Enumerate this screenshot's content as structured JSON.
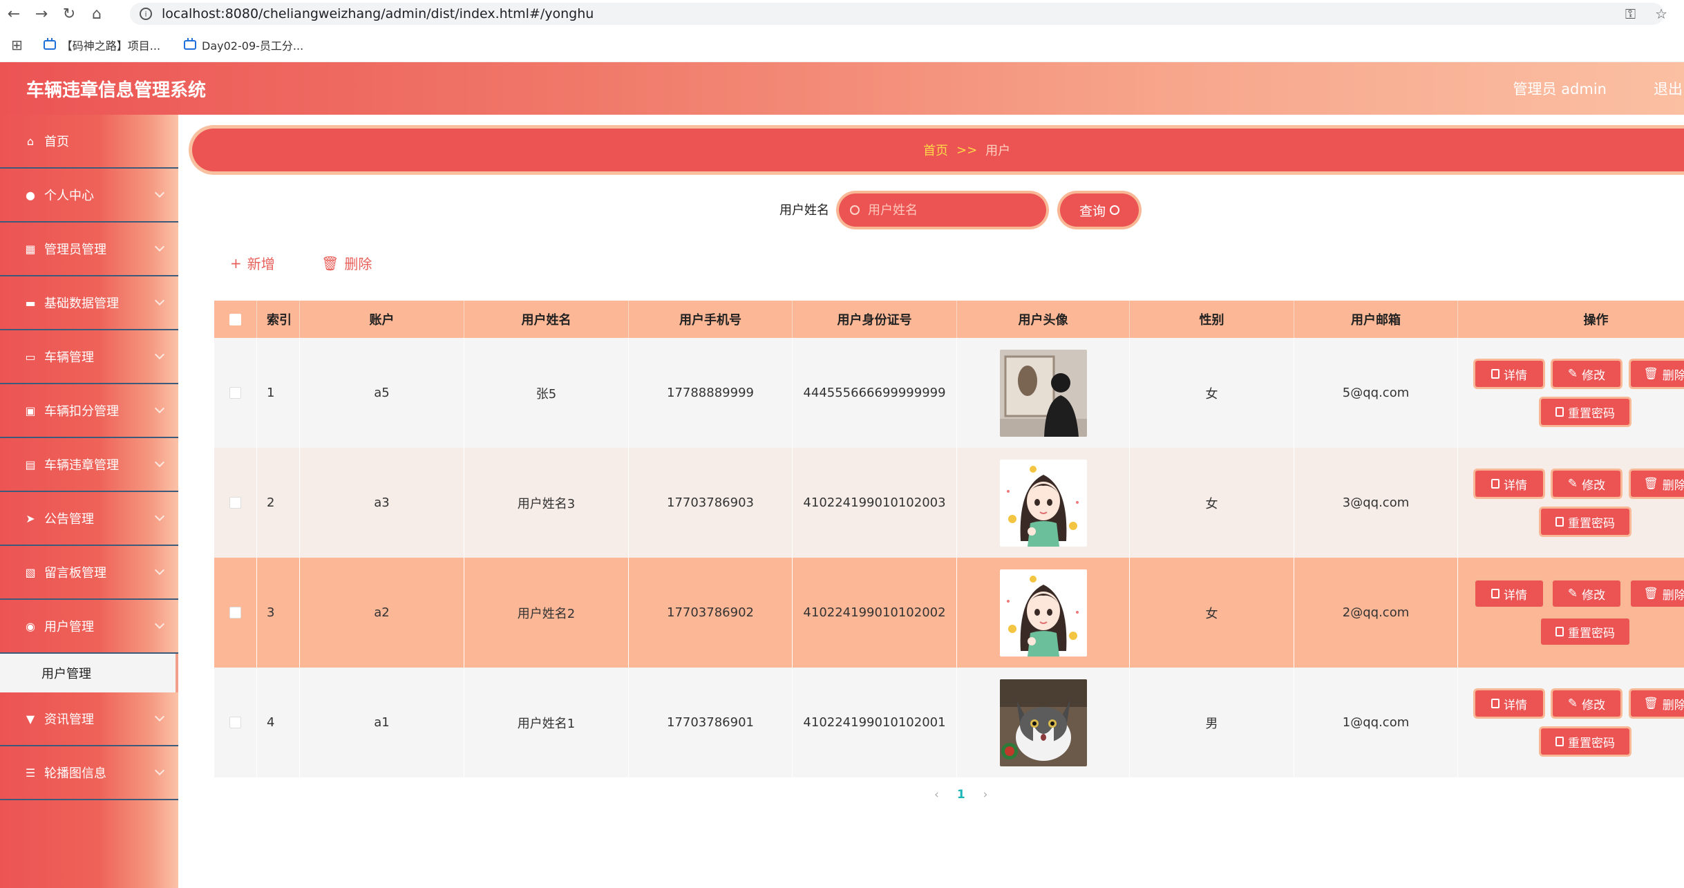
{
  "browser": {
    "url": "localhost:8080/cheliangweizhang/admin/dist/index.html#/yonghu",
    "bookmarks": [
      "【码神之路】项目...",
      "Day02-09-员工分..."
    ]
  },
  "header": {
    "title": "车辆违章信息管理系统",
    "admin": "管理员 admin",
    "logout": "退出"
  },
  "sidebar": {
    "items": [
      {
        "label": "首页",
        "icon": "home-icon"
      },
      {
        "label": "个人中心",
        "icon": "user-icon"
      },
      {
        "label": "管理员管理",
        "icon": "grid-icon"
      },
      {
        "label": "基础数据管理",
        "icon": "briefcase-icon"
      },
      {
        "label": "车辆管理",
        "icon": "monitor-icon"
      },
      {
        "label": "车辆扣分管理",
        "icon": "chat-icon"
      },
      {
        "label": "车辆违章管理",
        "icon": "clipboard-icon"
      },
      {
        "label": "公告管理",
        "icon": "send-icon"
      },
      {
        "label": "留言板管理",
        "icon": "picture-icon"
      },
      {
        "label": "用户管理",
        "icon": "person-icon"
      },
      {
        "label": "资讯管理",
        "icon": "news-icon"
      },
      {
        "label": "轮播图信息",
        "icon": "list-icon"
      }
    ],
    "submenu_active": "用户管理"
  },
  "breadcrumb": {
    "home": "首页",
    "sep": ">>",
    "current": "用户"
  },
  "search": {
    "label": "用户姓名",
    "placeholder": "用户姓名",
    "button": "查询"
  },
  "actions": {
    "add": "新增",
    "delete": "删除"
  },
  "table": {
    "headers": [
      "索引",
      "账户",
      "用户姓名",
      "用户手机号",
      "用户身份证号",
      "用户头像",
      "性别",
      "用户邮箱",
      "操作"
    ],
    "rows": [
      {
        "idx": "1",
        "account": "a5",
        "name": "张5",
        "phone": "17788889999",
        "idcard": "444555666699999999",
        "sex": "女",
        "email": "5@qq.com",
        "bg": "#f5f5f5",
        "avatar": "man-back"
      },
      {
        "idx": "2",
        "account": "a3",
        "name": "用户姓名3",
        "phone": "17703786903",
        "idcard": "410224199010102003",
        "sex": "女",
        "email": "3@qq.com",
        "bg": "#f6ece8",
        "avatar": "girl"
      },
      {
        "idx": "3",
        "account": "a2",
        "name": "用户姓名2",
        "phone": "17703786902",
        "idcard": "410224199010102002",
        "sex": "女",
        "email": "2@qq.com",
        "bg": "#fcb796",
        "avatar": "girl"
      },
      {
        "idx": "4",
        "account": "a1",
        "name": "用户姓名1",
        "phone": "17703786901",
        "idcard": "410224199010102001",
        "sex": "男",
        "email": "1@qq.com",
        "bg": "#f5f5f5",
        "avatar": "cat"
      }
    ],
    "ops": {
      "detail": "详情",
      "edit": "修改",
      "delete": "删除",
      "reset": "重置密码"
    }
  },
  "pager": {
    "prev": "‹",
    "current": "1",
    "next": "›"
  }
}
